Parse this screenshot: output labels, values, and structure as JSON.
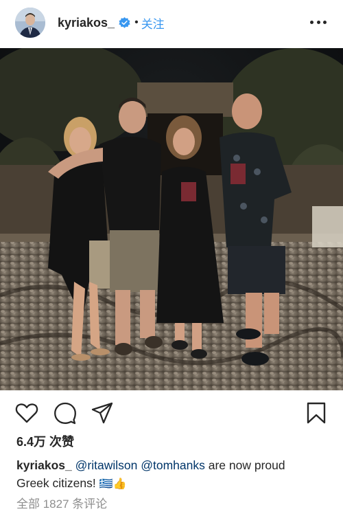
{
  "header": {
    "username": "kyriakos_",
    "separator": "•",
    "follow_label": "关注",
    "icons": {
      "avatar": "avatar-icon",
      "verified": "verified-badge-icon",
      "more": "more-options-icon"
    }
  },
  "actions": {
    "icons": [
      "heart-icon",
      "comment-icon",
      "send-icon",
      "bookmark-icon"
    ]
  },
  "likes": {
    "count": "6.4万",
    "label": "次赞"
  },
  "caption": {
    "username": "kyriakos_",
    "mention1": "@ritawilson",
    "mention2": "@tomhanks",
    "text_line1": " are now proud",
    "text_line2": "Greek citizens! ",
    "emoji": "🇬🇷👍"
  },
  "comments": {
    "label": "全部 1827 条评论"
  },
  "colors": {
    "accent": "#3897f0",
    "mention": "#003569",
    "muted": "#8e8e8e",
    "text": "#262626"
  }
}
